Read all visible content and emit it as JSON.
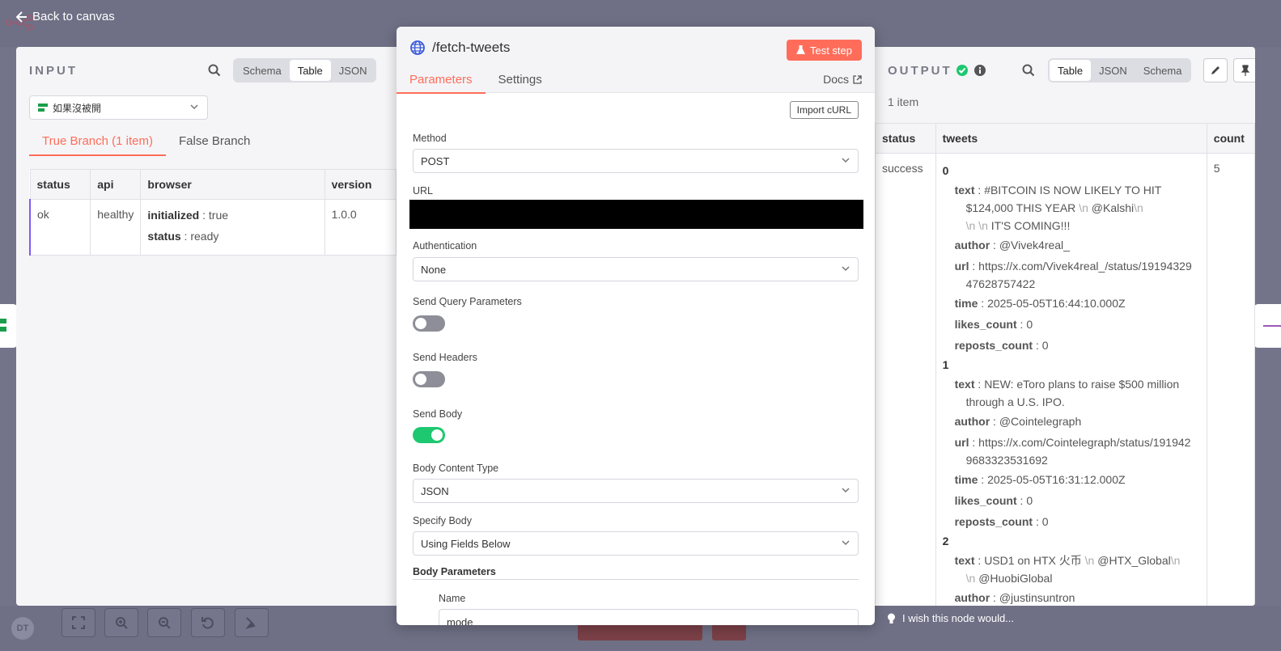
{
  "nav": {
    "back_label": "Back to canvas"
  },
  "input": {
    "title": "INPUT",
    "view_modes": [
      "Schema",
      "Table",
      "JSON"
    ],
    "selected_view": "Table",
    "node_selector": "如果沒被開",
    "branches": [
      {
        "label": "True Branch (1 item)",
        "active": true
      },
      {
        "label": "False Branch",
        "active": false
      }
    ],
    "columns": [
      "status",
      "api",
      "browser",
      "version"
    ],
    "row": {
      "status": "ok",
      "api": "healthy",
      "browser": [
        {
          "key": "initialized",
          "value": "true"
        },
        {
          "key": "status",
          "value": "ready"
        }
      ],
      "version": "1.0.0"
    }
  },
  "node": {
    "title": "/fetch-tweets",
    "test_label": "Test step",
    "tabs": [
      "Parameters",
      "Settings"
    ],
    "active_tab": "Parameters",
    "docs_label": "Docs",
    "import_curl": "Import cURL",
    "fields": {
      "method_label": "Method",
      "method_value": "POST",
      "url_label": "URL",
      "auth_label": "Authentication",
      "auth_value": "None",
      "send_query_label": "Send Query Parameters",
      "send_query": false,
      "send_headers_label": "Send Headers",
      "send_headers": false,
      "send_body_label": "Send Body",
      "send_body": true,
      "content_type_label": "Body Content Type",
      "content_type_value": "JSON",
      "specify_body_label": "Specify Body",
      "specify_body_value": "Using Fields Below",
      "body_params_label": "Body Parameters",
      "name_label": "Name",
      "name_value": "mode"
    }
  },
  "output": {
    "title": "OUTPUT",
    "view_modes": [
      "Table",
      "JSON",
      "Schema"
    ],
    "selected_view": "Table",
    "item_count": "1 item",
    "columns": [
      "status",
      "tweets",
      "count"
    ],
    "row": {
      "status": "success",
      "count": "5",
      "tweets": [
        {
          "index": "0",
          "text_parts": [
            "#BITCOIN IS NOW LIKELY TO HIT",
            "$124,000 THIS YEAR ",
            "\\n",
            "@Kalshi",
            "\\n",
            "\\n",
            "\\n",
            "IT'S COMING!!!"
          ],
          "author": "@Vivek4real_",
          "url_1": "https://x.com/Vivek4real_/status/19194329",
          "url_2": "47628757422",
          "time": "2025-05-05T16:44:10.000Z",
          "likes_count": "0",
          "reposts_count": "0"
        },
        {
          "index": "1",
          "text_1": " NEW: eToro plans to raise $500 million",
          "text_2": "through a U.S. IPO.",
          "author": "@Cointelegraph",
          "url_1": "https://x.com/Cointelegraph/status/191942",
          "url_2": "9683323531692",
          "time": "2025-05-05T16:31:12.000Z",
          "likes_count": "0",
          "reposts_count": "0"
        },
        {
          "index": "2",
          "text_1": "USD1 on HTX 火币 ",
          "text_esc": "\\n",
          "text_2": "@HTX_Global",
          "text_esc2": "\\n",
          "text_esc3": "\\n",
          "text_3": "@HuobiGlobal",
          "author": "@justinsuntron"
        }
      ]
    }
  },
  "footer": {
    "wish_label": "I wish this node would...",
    "avatar_initials": "DT"
  },
  "colors": {
    "accent": "#ff6d5a",
    "toggle_on": "#1ec870",
    "success": "#1ec870"
  }
}
